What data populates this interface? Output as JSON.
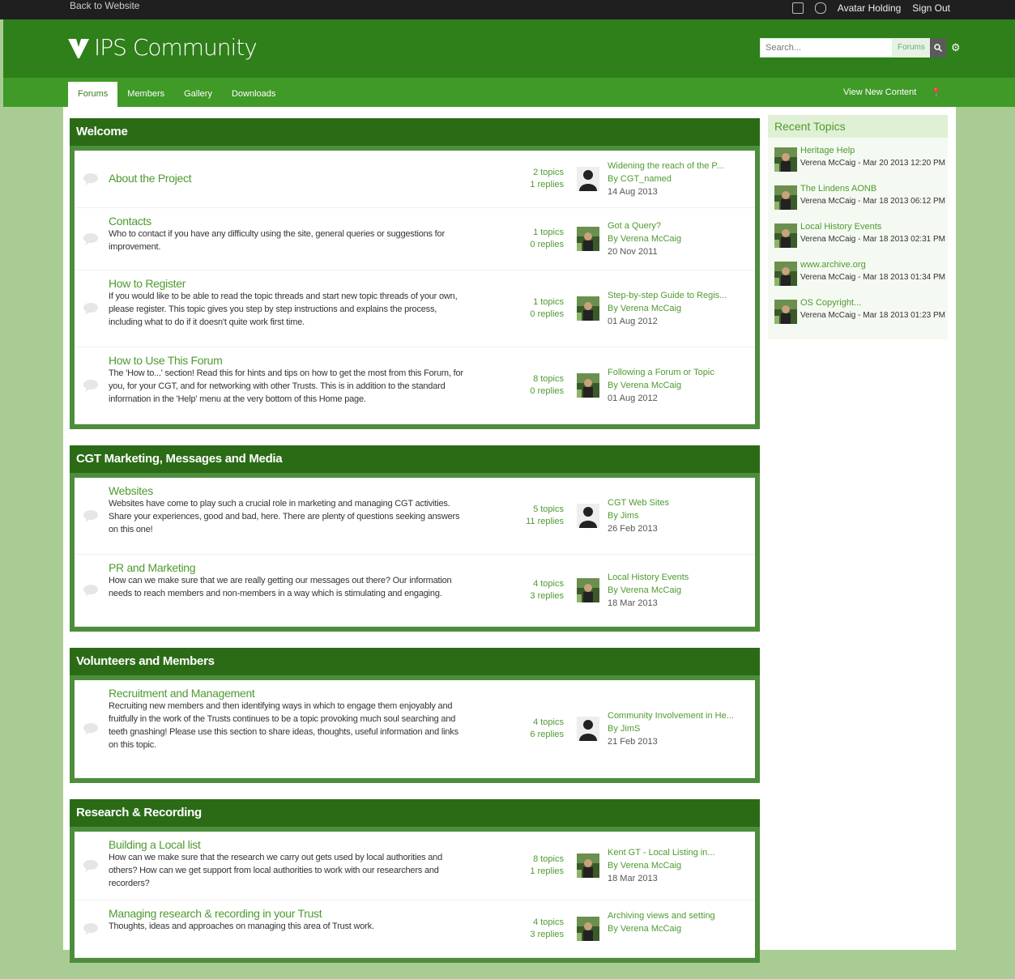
{
  "topbar": {
    "left": "Back to Website",
    "user": "Avatar Holding",
    "signout": "Sign Out"
  },
  "header": {
    "logo": "IPS Community",
    "search_placeholder": "Search...",
    "search_scope": "Forums"
  },
  "nav": {
    "tabs": [
      "Forums",
      "Members",
      "Gallery",
      "Downloads"
    ],
    "active": "Forums",
    "view_new": "View New Content"
  },
  "categories": [
    {
      "title": "Welcome",
      "forums": [
        {
          "title": "About the Project",
          "desc": "",
          "topics": "2 topics",
          "replies": "1 replies",
          "last_title": "Widening the reach of the P...",
          "last_by": "By CGT_named",
          "last_date": "14 Aug 2013"
        },
        {
          "title": "Contacts",
          "desc": "Who to contact if you have any difficulty using the site, general queries or suggestions for improvement.",
          "topics": "1 topics",
          "replies": "0 replies",
          "last_title": "Got a Query?",
          "last_by": "By Verena McCaig",
          "last_date": "20 Nov 2011"
        },
        {
          "title": "How to Register",
          "desc": "If you would like to be able to read the topic threads and start new topic threads of your own, please register. This topic gives you step by step instructions and explains the process, including what to do if it doesn't quite work first time.",
          "topics": "1 topics",
          "replies": "0 replies",
          "last_title": "Step-by-step Guide to Regis...",
          "last_by": "By Verena McCaig",
          "last_date": "01 Aug 2012"
        },
        {
          "title": "How to Use This Forum",
          "desc": "The 'How to...' section! Read this for hints and tips on how to get the most from this Forum, for you, for your CGT, and for networking with other Trusts. This is in addition to the standard information in the 'Help' menu at the very bottom of this Home page.",
          "topics": "8 topics",
          "replies": "0 replies",
          "last_title": "Following a Forum or Topic",
          "last_by": "By Verena McCaig",
          "last_date": "01 Aug 2012"
        }
      ]
    },
    {
      "title": "CGT Marketing, Messages and Media",
      "forums": [
        {
          "title": "Websites",
          "desc": "Websites have come to play such a crucial role in marketing and managing CGT activities. Share your experiences, good and bad, here. There are plenty of questions seeking answers on this one!",
          "topics": "5 topics",
          "replies": "11 replies",
          "last_title": "CGT Web Sites",
          "last_by": "By Jims",
          "last_date": "26 Feb 2013"
        },
        {
          "title": "PR and Marketing",
          "desc": "How can we make sure that we are really getting our messages out there? Our information needs to reach members and non-members in a way which is stimulating and engaging.",
          "topics": "4 topics",
          "replies": "3 replies",
          "last_title": "Local History Events",
          "last_by": "By Verena McCaig",
          "last_date": "18 Mar 2013"
        }
      ]
    },
    {
      "title": "Volunteers and Members",
      "forums": [
        {
          "title": "Recruitment and Management",
          "desc": "Recruiting new members and then identifying ways in which to engage them enjoyably and fruitfully in the work of the Trusts continues to be a topic provoking much soul searching and teeth gnashing! Please use this section to share ideas, thoughts, useful information and links on this topic.",
          "topics": "4 topics",
          "replies": "6 replies",
          "last_title": "Community Involvement in He...",
          "last_by": "By JimS",
          "last_date": "21 Feb 2013"
        }
      ]
    },
    {
      "title": "Research & Recording",
      "forums": [
        {
          "title": "Building a Local list",
          "desc": "How can we make sure that the research we carry out gets used by local authorities and others? How can we get support from local authorities to work with our researchers and recorders?",
          "topics": "8 topics",
          "replies": "1 replies",
          "last_title": "Kent GT - Local Listing in...",
          "last_by": "By Verena McCaig",
          "last_date": "18 Mar 2013"
        },
        {
          "title": "Managing research & recording in your Trust",
          "desc": "Thoughts, ideas and approaches on managing this area of Trust work.",
          "topics": "4 topics",
          "replies": "3 replies",
          "last_title": "Archiving views and setting",
          "last_by": "By Verena McCaig",
          "last_date": ""
        }
      ]
    }
  ],
  "sidebar": {
    "title": "Recent Topics",
    "items": [
      {
        "title": "Heritage Help",
        "meta": "Verena McCaig - Mar 20 2013 12:20 PM"
      },
      {
        "title": "The Lindens AONB",
        "meta": "Verena McCaig - Mar 18 2013 06:12 PM"
      },
      {
        "title": "Local History Events",
        "meta": "Verena McCaig - Mar 18 2013 02:31 PM"
      },
      {
        "title": "www.archive.org",
        "meta": "Verena McCaig - Mar 18 2013 01:34 PM"
      },
      {
        "title": "OS Copyright...",
        "meta": "Verena McCaig - Mar 18 2013 01:23 PM"
      }
    ]
  },
  "colors": {
    "header": "#2f7f1a",
    "nav": "#3f9a27",
    "category_head": "#2b6b16",
    "link": "#4f9a30",
    "page_bg": "#a9cc95"
  },
  "icons": [
    "gear-icon",
    "search-icon",
    "pin-icon",
    "forum-bubble-icon",
    "avatar-icon"
  ]
}
